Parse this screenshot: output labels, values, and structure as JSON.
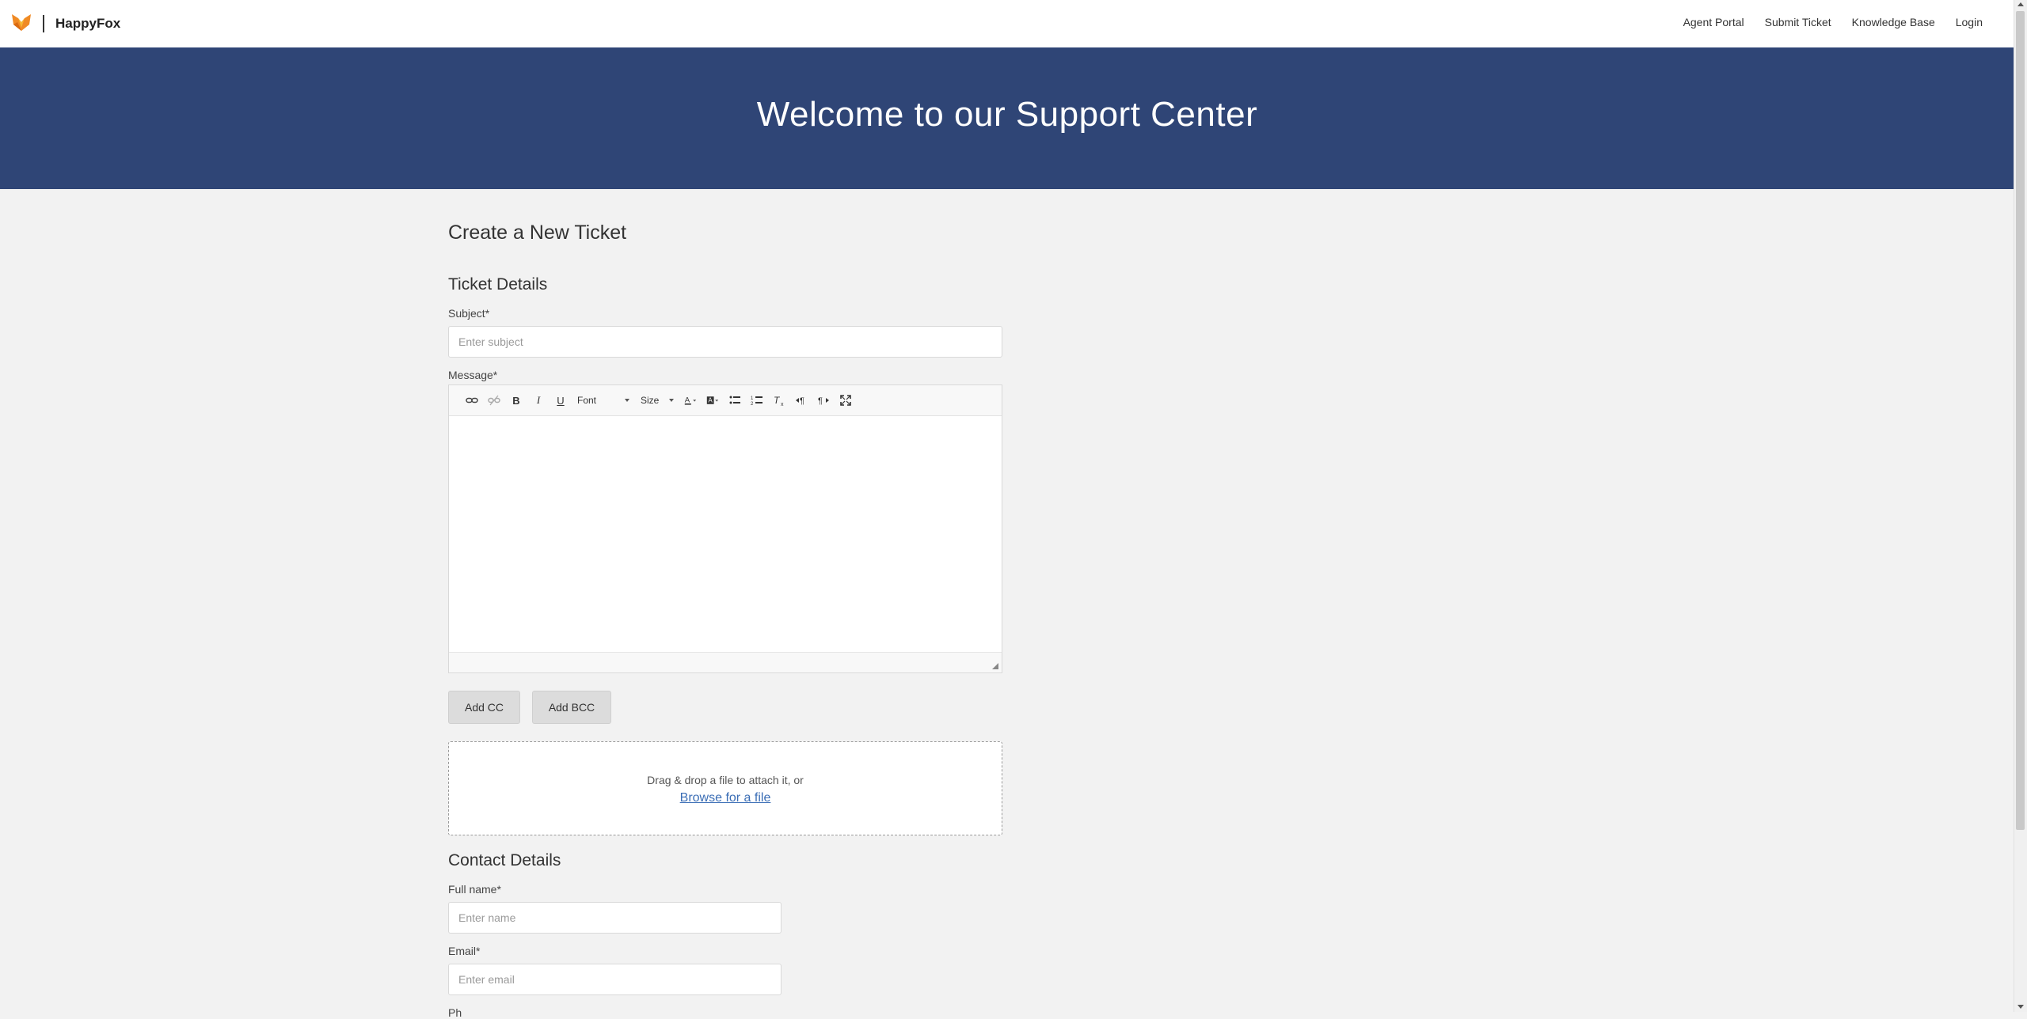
{
  "header": {
    "brand": "HappyFox",
    "nav": [
      "Agent Portal",
      "Submit Ticket",
      "Knowledge Base",
      "Login"
    ],
    "logo_colors": {
      "orange": "#f08a24",
      "light": "#f7b733"
    }
  },
  "hero": {
    "title": "Welcome to our Support Center",
    "bg_color": "#2f4576"
  },
  "form": {
    "page_title": "Create a New Ticket",
    "ticket_section": "Ticket Details",
    "subject_label": "Subject*",
    "subject_placeholder": "Enter subject",
    "message_label": "Message*",
    "toolbar": {
      "font_label": "Font",
      "size_label": "Size",
      "bold": "B",
      "italic": "I",
      "underline": "U"
    },
    "add_cc": "Add CC",
    "add_bcc": "Add BCC",
    "dropzone_text": "Drag & drop a file to attach it, or",
    "dropzone_link": "Browse for a file",
    "contact_section": "Contact Details",
    "name_label": "Full name*",
    "name_placeholder": "Enter name",
    "email_label": "Email*",
    "email_placeholder": "Enter email",
    "phone_label_partial": "Ph"
  }
}
